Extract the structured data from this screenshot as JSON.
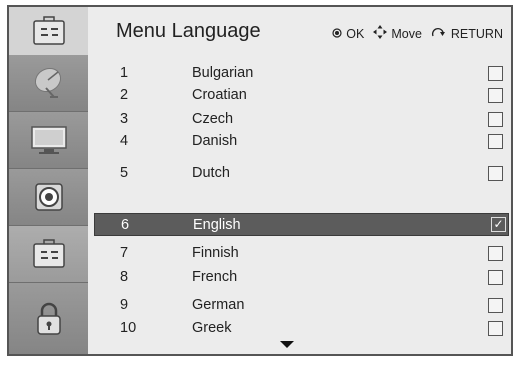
{
  "header": {
    "title": "Menu Language",
    "hints": [
      {
        "icon": "ok-icon",
        "label": "OK"
      },
      {
        "icon": "move-arrows-icon",
        "label": "Move"
      },
      {
        "icon": "return-icon",
        "label": "RETURN"
      }
    ]
  },
  "sidebar": {
    "items": [
      {
        "icon": "satellite-dish-icon",
        "active": false
      },
      {
        "icon": "tv-screen-icon",
        "active": false
      },
      {
        "icon": "speaker-icon",
        "active": false
      },
      {
        "icon": "toolbox-icon",
        "active": true
      },
      {
        "icon": "padlock-icon",
        "active": false
      }
    ]
  },
  "languages": [
    {
      "num": "1",
      "name": "Bulgarian",
      "checked": false
    },
    {
      "num": "2",
      "name": "Croatian",
      "checked": false
    },
    {
      "num": "3",
      "name": "Czech",
      "checked": false
    },
    {
      "num": "4",
      "name": "Danish",
      "checked": false
    },
    {
      "num": "5",
      "name": "Dutch",
      "checked": false
    },
    {
      "num": "6",
      "name": "English",
      "checked": true,
      "selected": true
    },
    {
      "num": "7",
      "name": "Finnish",
      "checked": false
    },
    {
      "num": "8",
      "name": "French",
      "checked": false
    },
    {
      "num": "9",
      "name": "German",
      "checked": false
    },
    {
      "num": "10",
      "name": "Greek",
      "checked": false
    }
  ],
  "checkmark": "✓"
}
